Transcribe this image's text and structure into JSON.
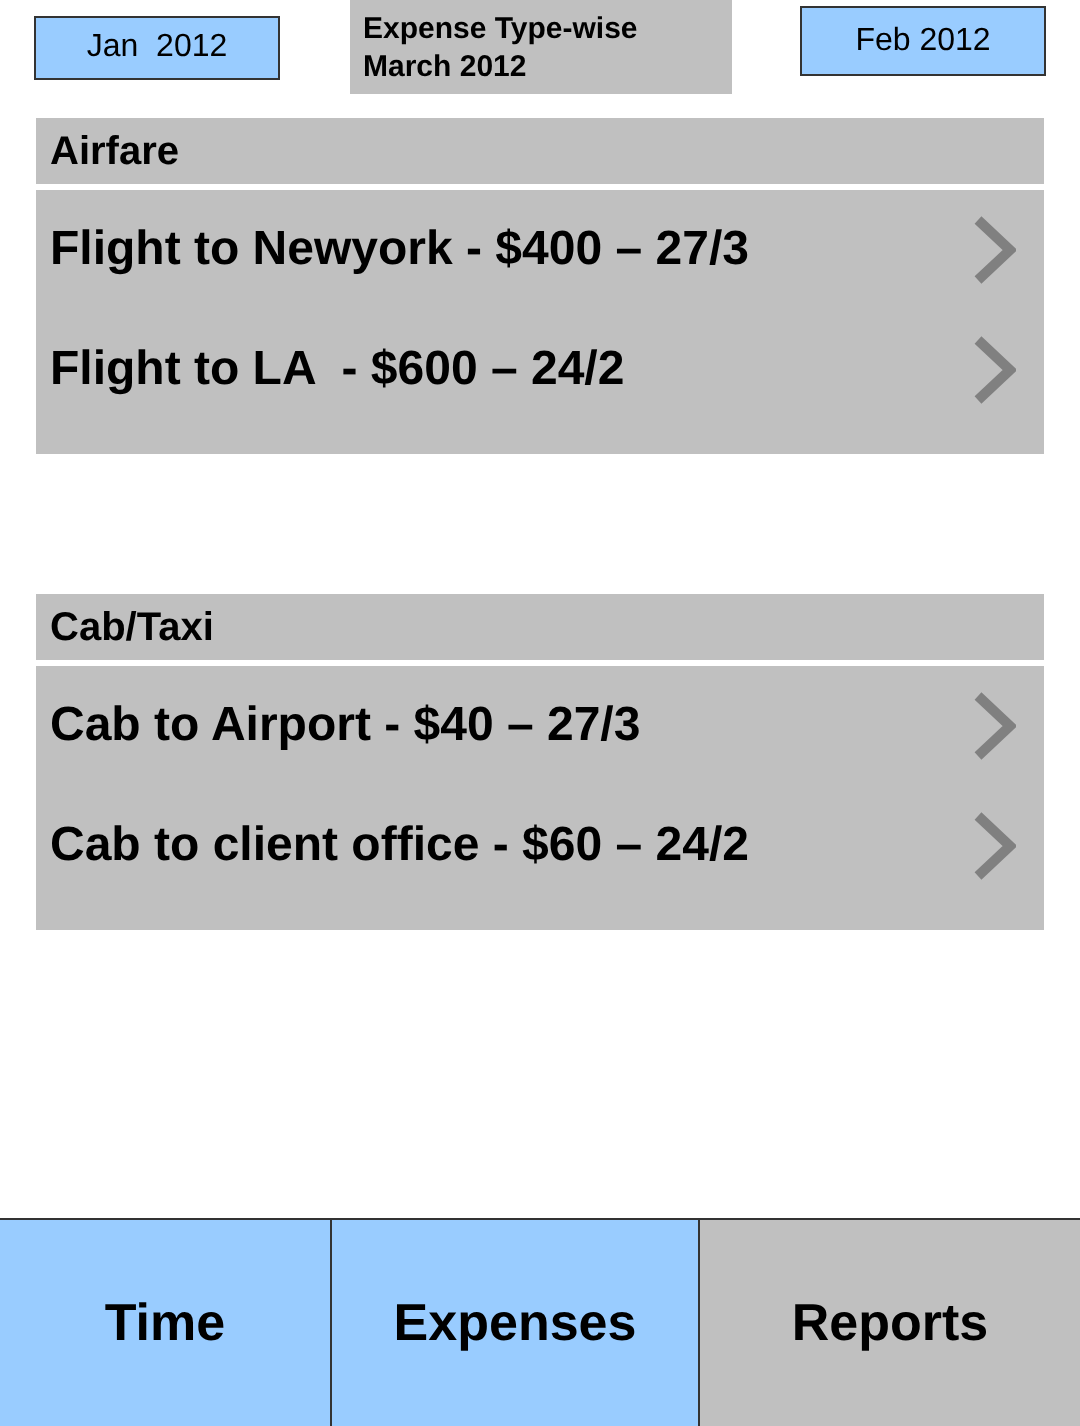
{
  "header": {
    "prev_month": "Jan  2012",
    "title_line_1": "Expense Type-wise",
    "title_line_2": "March 2012",
    "next_month": "Feb 2012"
  },
  "sections": [
    {
      "title": "Airfare",
      "items": [
        "Flight to Newyork - $400 – 27/3",
        "Flight to LA  - $600 – 24/2"
      ]
    },
    {
      "title": "Cab/Taxi",
      "items": [
        "Cab to Airport - $40 – 27/3",
        "Cab to client office - $60 – 24/2"
      ]
    }
  ],
  "tabs": [
    {
      "label": "Time",
      "color": "#99ccff"
    },
    {
      "label": "Expenses",
      "color": "#99ccff"
    },
    {
      "label": "Reports",
      "color": "#c0c0c0"
    }
  ]
}
